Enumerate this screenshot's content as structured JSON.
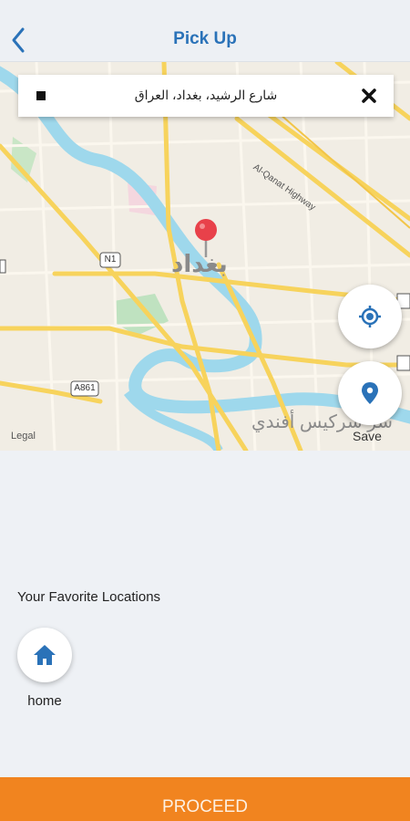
{
  "header": {
    "title": "Pick Up"
  },
  "search": {
    "address": "شارع الرشيد، بغداد، العراق"
  },
  "map": {
    "city_label": "بغداد",
    "road_labels": {
      "n1": "N1",
      "a861": "A861",
      "highway": "Al-Qanat Highway"
    },
    "district_label": "سر سركيس أفندي",
    "legal": "Legal",
    "save_label": "Save"
  },
  "favorites": {
    "title": "Your Favorite Locations",
    "items": [
      {
        "label": "home",
        "icon": "home-icon"
      }
    ]
  },
  "footer": {
    "proceed_label": "PROCEED"
  },
  "colors": {
    "accent": "#2a72b8",
    "proceed": "#f1841f",
    "river": "#9ed8ec",
    "road": "#f7d35c",
    "pin": "#e8414a"
  }
}
